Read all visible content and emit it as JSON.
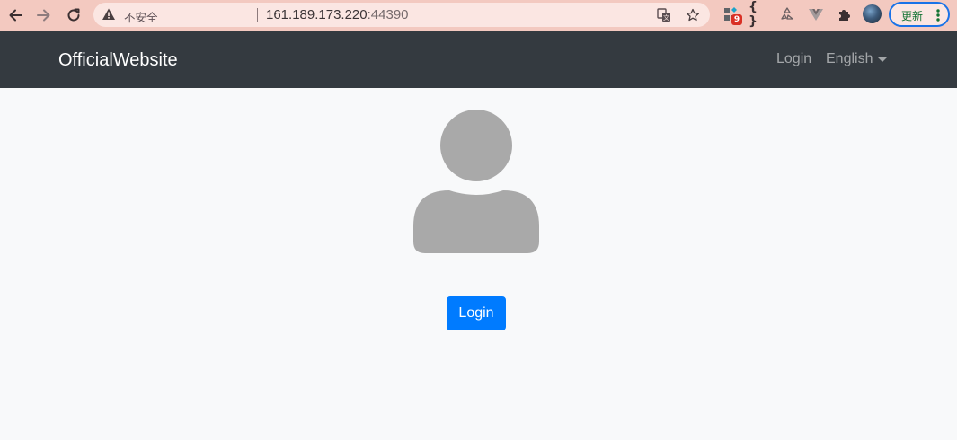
{
  "browser": {
    "security_label": "不安全",
    "url_host": "161.189.173.220",
    "url_port": ":44390",
    "extensions": {
      "badge_count": "9",
      "json_ext_label": "{ }"
    },
    "update_label": "更新",
    "icons": [
      "back-arrow-icon",
      "forward-arrow-icon",
      "reload-icon",
      "warning-icon",
      "translate-icon",
      "star-icon",
      "puzzle-icon",
      "more-vertical-icon"
    ]
  },
  "navbar": {
    "brand": "OfficialWebsite",
    "login": "Login",
    "language": "English"
  },
  "main": {
    "login_button": "Login"
  },
  "colors": {
    "navbar_bg": "#343a40",
    "primary": "#007bff",
    "page_bg": "#f8f9fa",
    "avatar_gray": "#a9a9a9",
    "chrome_bg": "#f3c9c0"
  }
}
